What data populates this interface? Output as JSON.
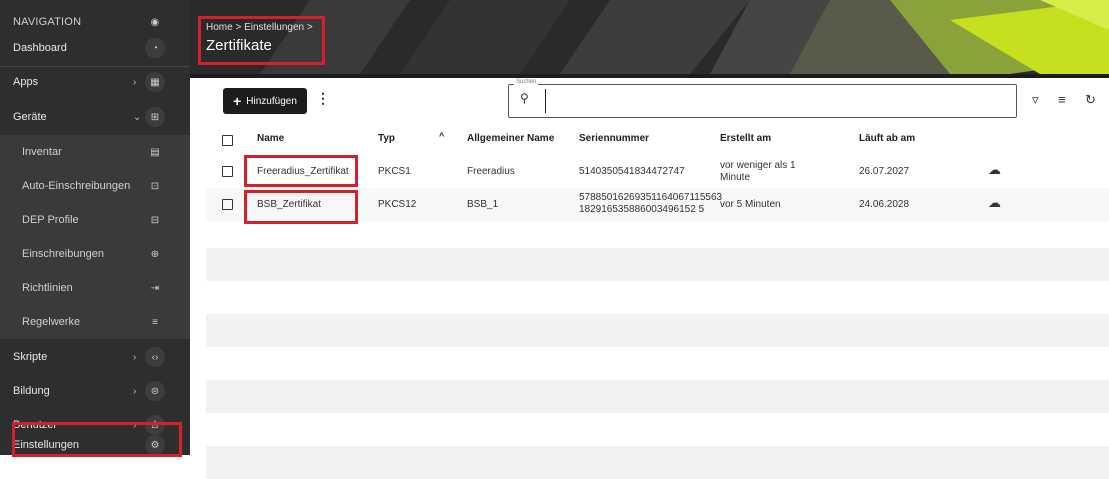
{
  "sidebar": {
    "header": "NAVIGATION",
    "items": [
      {
        "label": "Dashboard",
        "icon": "gauge-icon",
        "glyph": "◔"
      },
      {
        "label": "Apps",
        "icon": "grid-icon",
        "glyph": "▦",
        "chevron": "›"
      },
      {
        "label": "Geräte",
        "icon": "devices-icon",
        "glyph": "⊞",
        "chevron": "⌄"
      },
      {
        "label": "Inventar",
        "icon": "inventory-icon",
        "glyph": "▤"
      },
      {
        "label": "Auto-Einschreibungen",
        "icon": "auto-enroll-icon",
        "glyph": "⊡"
      },
      {
        "label": "DEP Profile",
        "icon": "dep-profile-icon",
        "glyph": "⊟"
      },
      {
        "label": "Einschreibungen",
        "icon": "enrollment-icon",
        "glyph": "⊕"
      },
      {
        "label": "Richtlinien",
        "icon": "policy-icon",
        "glyph": "⇥"
      },
      {
        "label": "Regelwerke",
        "icon": "ruleset-icon",
        "glyph": "≡"
      },
      {
        "label": "Skripte",
        "icon": "code-icon",
        "glyph": "‹›",
        "chevron": "›"
      },
      {
        "label": "Bildung",
        "icon": "education-icon",
        "glyph": "⊜",
        "chevron": "›"
      },
      {
        "label": "Benutzer",
        "icon": "users-icon",
        "glyph": "♙",
        "chevron": "›"
      },
      {
        "label": "Einstellungen",
        "icon": "settings-gear-icon",
        "glyph": "⚙"
      }
    ]
  },
  "header": {
    "breadcrumb": "Home > Einstellungen >",
    "title": "Zertifikate"
  },
  "toolbar": {
    "add_label": "Hinzufügen",
    "search_legend": "Suchen",
    "search_value": ""
  },
  "table": {
    "columns": [
      "Name",
      "Typ",
      "Allgemeiner Name",
      "Seriennummer",
      "Erstellt am",
      "Läuft ab am"
    ],
    "rows": [
      {
        "name": "Freeradius_Zertifikat",
        "typ": "PKCS1",
        "common_name": "Freeradius",
        "serial_1": "5140350541834472747",
        "serial_2": "",
        "created_1": "vor weniger als 1",
        "created_2": "Minute",
        "expires": "26.07.2027"
      },
      {
        "name": "BSB_Zertifikat",
        "typ": "PKCS12",
        "common_name": "BSB_1",
        "serial_1": "57885016269351164067115563",
        "serial_2": "182916535886003496152 5",
        "created_1": "vor 5 Minuten",
        "created_2": "",
        "expires": "24.06.2028"
      }
    ]
  },
  "colors": {
    "highlight": "#d61f2c",
    "accent_lime": "#c6df1f",
    "sidebar_bg": "#2e2e2e"
  }
}
